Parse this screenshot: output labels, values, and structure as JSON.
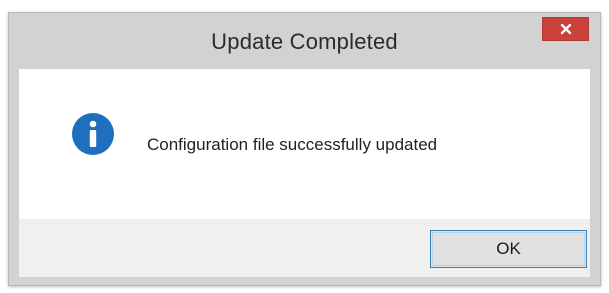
{
  "dialog": {
    "title": "Update Completed",
    "close_icon": "close-icon",
    "icon": "info-icon",
    "message": "Configuration file successfully updated",
    "ok_label": "OK"
  },
  "colors": {
    "close_button": "#c9413a",
    "info_icon": "#1f6fbf",
    "ok_border": "#3c7fb1"
  }
}
